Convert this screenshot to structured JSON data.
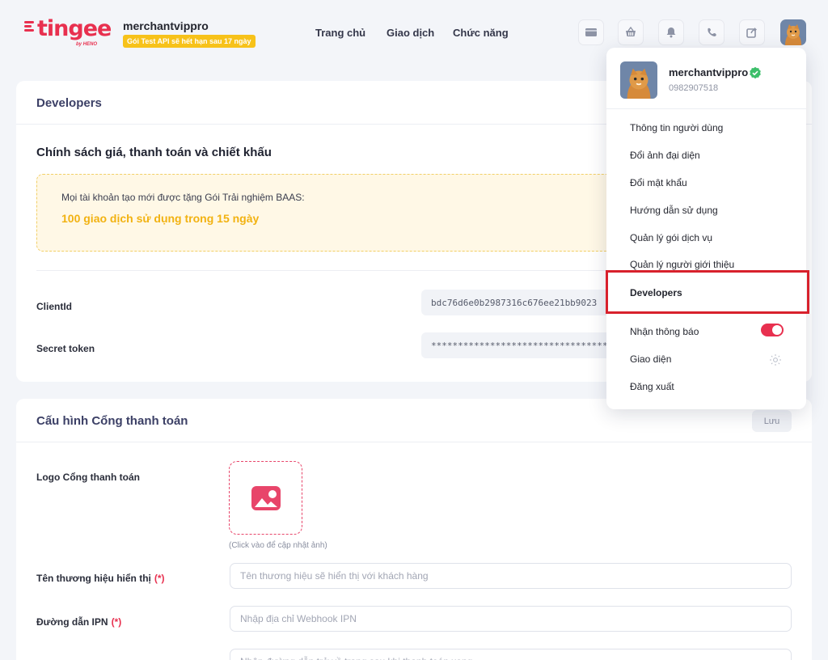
{
  "brand": {
    "name": "tingee",
    "sub": "by HENO"
  },
  "header": {
    "merchant": "merchantvippro",
    "trial_badge": "Gói Test API sẽ hết hạn sau 17 ngày",
    "nav": [
      "Trang chủ",
      "Giao dịch",
      "Chức năng"
    ],
    "icons": [
      "wallet-icon",
      "basket-icon",
      "bell-icon",
      "support-icon",
      "share-icon",
      "avatar"
    ]
  },
  "developers_card": {
    "title": "Developers",
    "policy_title": "Chính sách giá, thanh toán và chiết khấu",
    "promo_line1": "Mọi tài khoản tạo mới được tặng Gói Trải nghiệm BAAS:",
    "promo_line2": "100 giao dịch sử dụng trong 15 ngày",
    "client_id_label": "ClientId",
    "client_id_value": "bdc76d6e0b2987316c676ee21bb9023",
    "secret_label": "Secret token",
    "secret_value": "****************************************"
  },
  "gateway_card": {
    "title": "Cấu hình Cổng thanh toán",
    "save_label": "Lưu",
    "logo_label": "Logo Cổng thanh toán",
    "logo_hint": "(Click vào để cập nhật ảnh)",
    "brand_label": "Tên thương hiệu hiển thị",
    "brand_placeholder": "Tên thương hiệu sẽ hiển thị với khách hàng",
    "ipn_label": "Đường dẫn IPN",
    "ipn_placeholder": "Nhập địa chỉ Webhook IPN",
    "redirect_placeholder": "Nhập đường dẫn trở về trang sau khi thanh toán xong",
    "required_mark": "(*)"
  },
  "user_menu": {
    "name": "merchantvippro",
    "phone": "0982907518",
    "items": [
      "Thông tin người dùng",
      "Đổi ảnh đại diện",
      "Đổi mật khẩu",
      "Hướng dẫn sử dụng",
      "Quản lý gói dịch vụ",
      "Quản lý người giới thiệu",
      "Developers",
      "Nhận thông báo",
      "Giao diện",
      "Đăng xuất"
    ],
    "active_item": "Developers",
    "notifications_on": true
  },
  "colors": {
    "accent": "#e8304f",
    "highlight": "#d8212c",
    "promo": "#f2b211"
  }
}
